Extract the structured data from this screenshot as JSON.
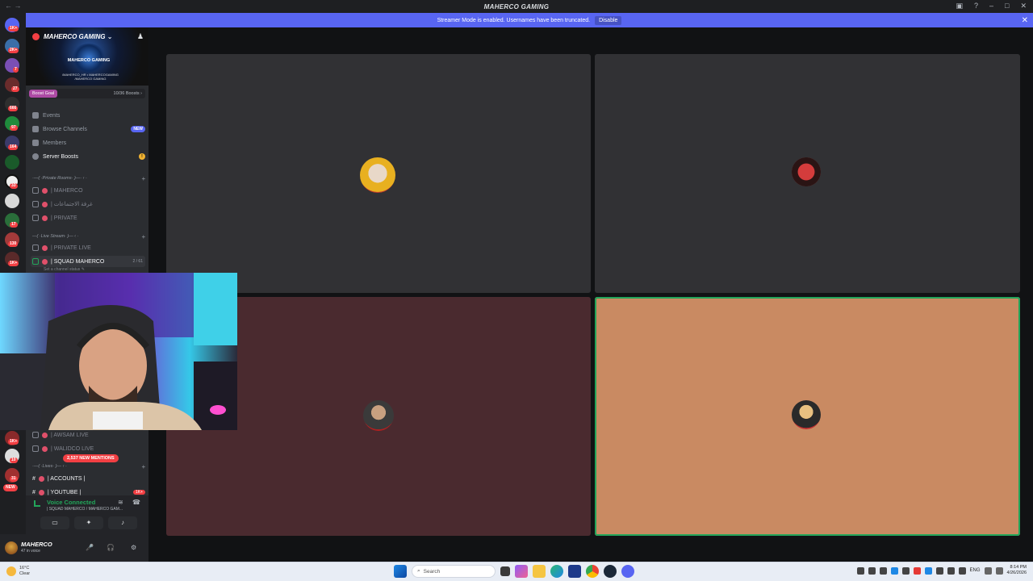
{
  "window": {
    "title": "MAHERCO GAMING",
    "nav_back": "←",
    "nav_forward": "→",
    "controls": [
      "▣",
      "?",
      "–",
      "□",
      "✕"
    ]
  },
  "banner": {
    "text": "Streamer Mode is enabled. Usernames have been truncated.",
    "disable_label": "Disable",
    "close": "✕"
  },
  "rail_badges": [
    "1K+",
    "2K+",
    "7",
    "27",
    "666",
    "97",
    "164",
    "33",
    "17",
    "130",
    "1K+",
    "1K+",
    "10",
    "31"
  ],
  "rail_new": "NEW",
  "server": {
    "name": "MAHERCO GAMING",
    "chevron": "⌄",
    "invite_icon": "♟",
    "logo_text": "MAHERCO GAMING",
    "logo_sub": "/MAHERCO_HR • MAHERCOGAMING\n/MAHERCO GAMING",
    "boost_goal_label": "Boost Goal",
    "boost_count": "10/36 Boosts ›"
  },
  "menu": {
    "events": "Events",
    "browse": "Browse Channels",
    "browse_badge": "NEW",
    "members": "Members",
    "server_boosts": "Server Boosts",
    "server_boosts_badge": "!"
  },
  "categories": {
    "private_rooms": "·—( ·Private Rooms· )—·  ‹ ·",
    "live_stream": "—( ·Live Stream· )—  ‹ ·",
    "lives": "·—( ·Lives· )—  ‹ ·"
  },
  "channels": {
    "maherco": "| MAHERCO",
    "arabic": "| غرفة الاجتماعات",
    "private": "| PRIVATE",
    "private_live": "| PRIVATE LIVE",
    "squad": "| SQUAD MAHERCO",
    "squad_count": "2 / 61",
    "squad_status": "Set a channel status ✎",
    "awsam_live": "| AWSAM LIVE",
    "walidco_live": "| WALIDCO LIVE",
    "accounts": "| ACCOUNTS |",
    "youtube": "| YOUTUBE |",
    "youtube_badge": "1K+",
    "mentions": "2,537 NEW MENTIONS"
  },
  "voice": {
    "title": "Voice Connected",
    "subtitle": "| SQUAD MAHERCO / MAHERCO GAM...",
    "btn_screen": "▭",
    "btn_activity": "✦",
    "btn_soundboard": "♪"
  },
  "user": {
    "name": "MAHERCO",
    "status": "47 in voice",
    "mic": "🎤",
    "headset": "🎧",
    "settings": "⚙"
  },
  "taskbar": {
    "temp": "16°C",
    "cond": "Clear",
    "search_placeholder": "Search",
    "lang": "ENG",
    "time": "8:14 PM",
    "date": "4/26/2026"
  },
  "colors": {
    "accent": "#5865f2",
    "tile_dark": "#313134",
    "tile_maroon": "#4a2a2f",
    "tile_orange": "#c98a62",
    "speaking": "#23a55a"
  }
}
